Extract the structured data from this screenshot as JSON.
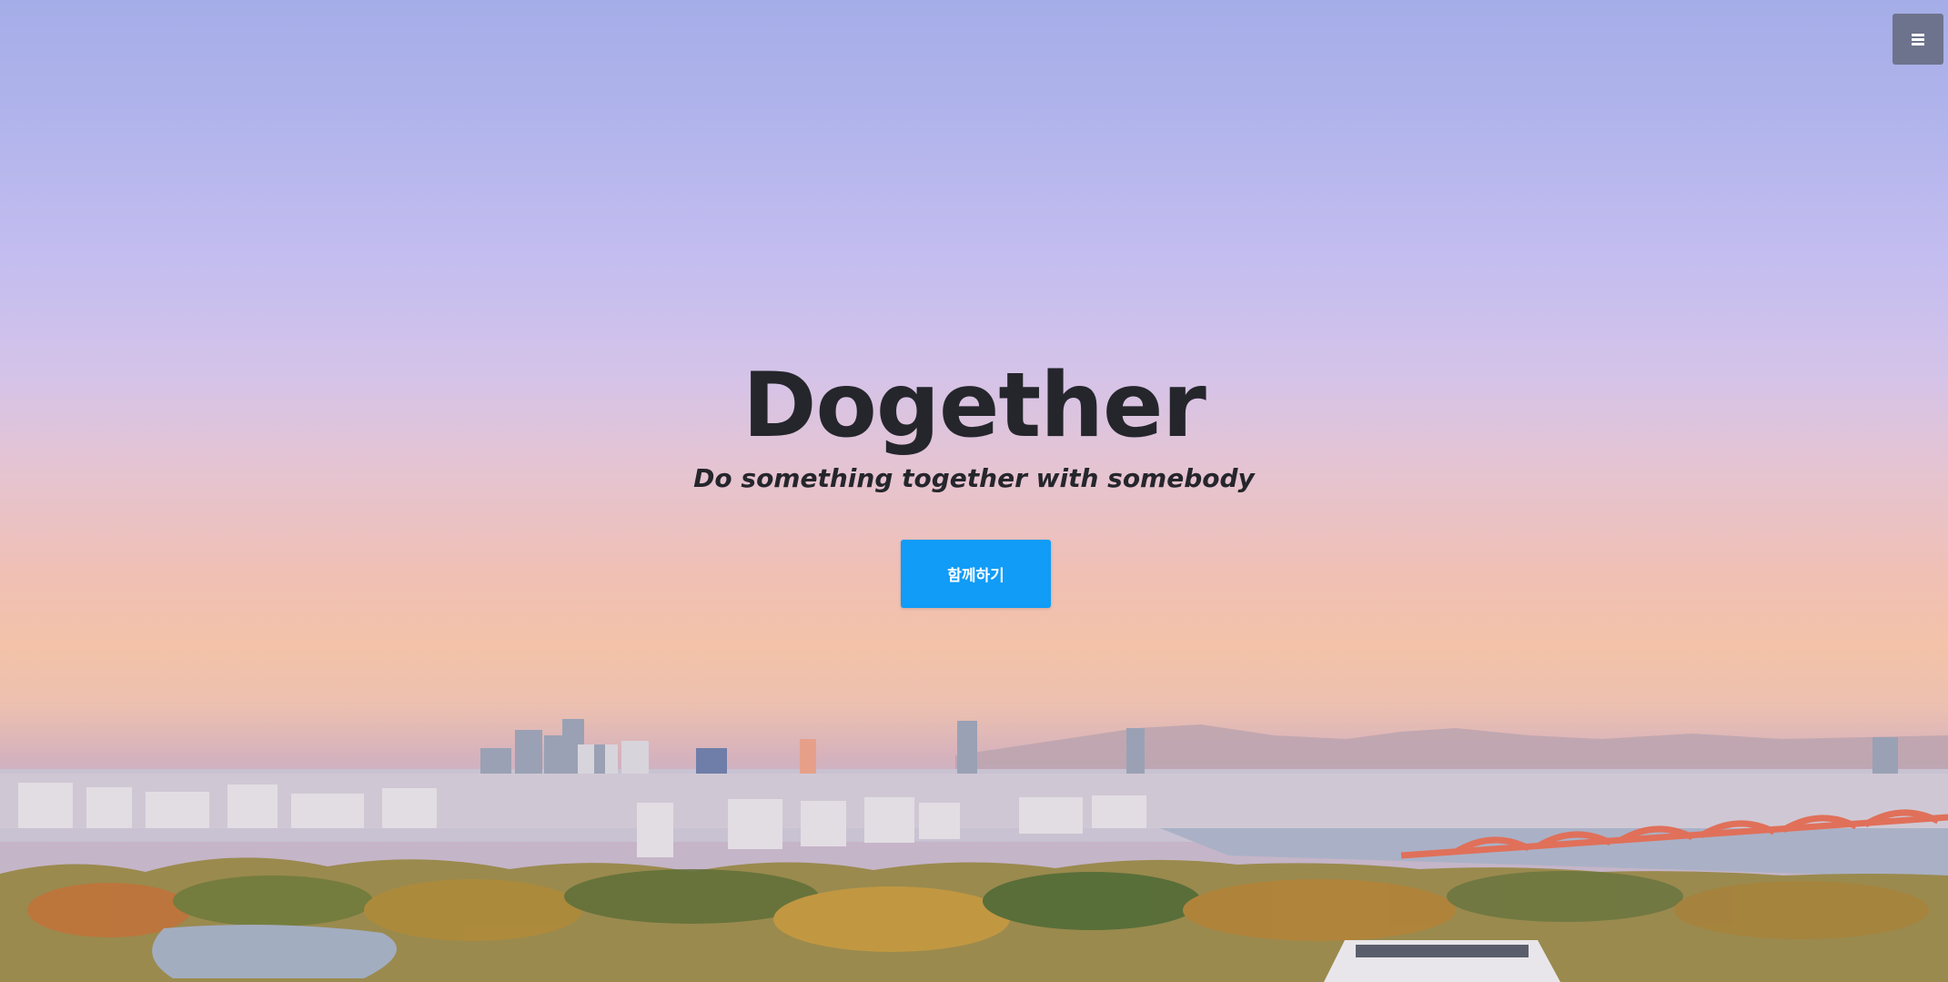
{
  "hero": {
    "title": "Dogether",
    "subtitle": "Do something together with somebody",
    "cta_label": "함께하기"
  },
  "menu": {
    "icon": "hamburger-menu-icon"
  },
  "colors": {
    "cta_background": "#109cf7",
    "menu_background": "#6d738c",
    "title_text": "#25262c"
  }
}
